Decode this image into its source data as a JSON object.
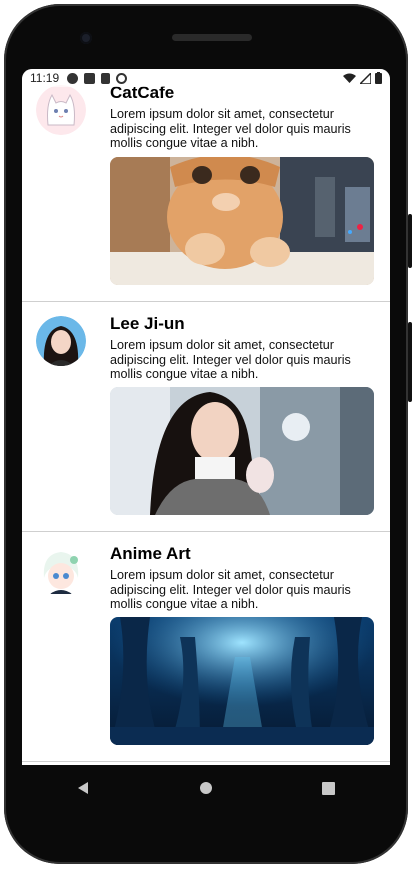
{
  "status_bar": {
    "time": "11:19",
    "left_icons": [
      "a-badge-icon",
      "app-icon",
      "sd-card-icon",
      "sync-icon"
    ],
    "right_icons": [
      "wifi-icon",
      "signal-icon",
      "battery-icon"
    ]
  },
  "posts": [
    {
      "name": "CatCafe",
      "text": "Lorem ipsum dolor sit amet, consectetur adipiscing elit. Integer vel dolor quis mauris mollis congue vitae a nibh.",
      "avatar_icon": "cat-cartoon-avatar",
      "image_icon": "cat-photo"
    },
    {
      "name": "Lee Ji-un",
      "text": "Lorem ipsum dolor sit amet, consectetur adipiscing elit. Integer vel dolor quis mauris mollis congue vitae a nibh.",
      "avatar_icon": "person-avatar",
      "image_icon": "person-photo"
    },
    {
      "name": "Anime Art",
      "text": "Lorem ipsum dolor sit amet, consectetur adipiscing elit. Integer vel dolor quis mauris mollis congue vitae a nibh.",
      "avatar_icon": "anime-avatar",
      "image_icon": "blue-forest-art"
    }
  ],
  "nav_bar": {
    "buttons": [
      "back-icon",
      "home-icon",
      "recents-icon"
    ]
  },
  "colors": {
    "divider": "#cfcfcf",
    "phone_frame": "#0a0a0a"
  }
}
